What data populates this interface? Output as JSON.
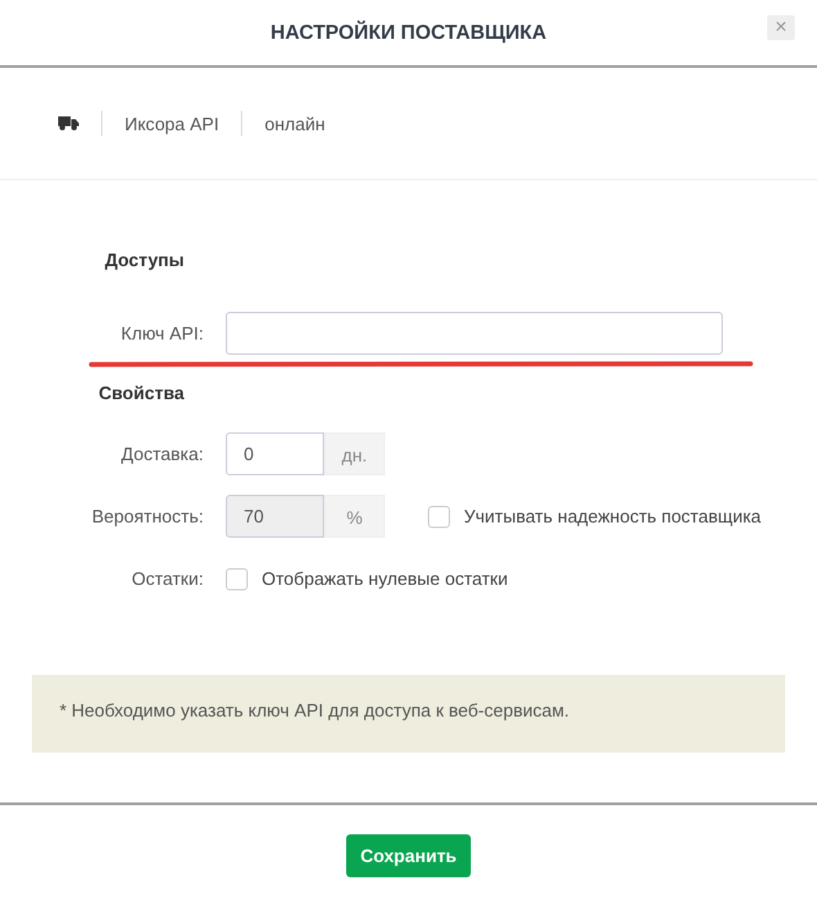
{
  "dialog": {
    "title": "НАСТРОЙКИ ПОСТАВЩИКА",
    "close": "×"
  },
  "info": [
    "Иксора API",
    "онлайн"
  ],
  "access": {
    "heading": "Доступы",
    "api_key": {
      "label": "Ключ API:"
    }
  },
  "properties": {
    "heading": "Свойства",
    "rows": [
      {
        "kind": "input",
        "label": "Доставка:",
        "value": "0",
        "unit": "дн.",
        "disabled": false
      },
      {
        "kind": "input",
        "label": "Вероятность:",
        "value": "70",
        "unit": "%",
        "disabled": true,
        "checkbox": {
          "label": "Учитывать надежность поставщика",
          "checked": false
        }
      },
      {
        "kind": "checkbox",
        "label": "Остатки:",
        "checkbox": {
          "label": "Отображать нулевые остатки",
          "checked": false
        }
      }
    ]
  },
  "note": "* Необходимо указать ключ API для доступа к веб-сервисам.",
  "save_button": "Сохранить"
}
